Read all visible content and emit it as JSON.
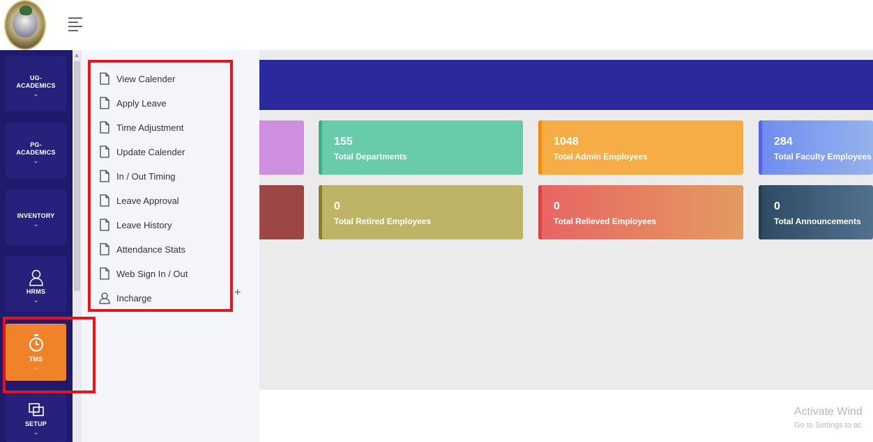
{
  "header": {
    "logo_icon": "college-seal-logo",
    "menu_icon": "hamburger-menu-icon"
  },
  "sidebar": {
    "items": [
      {
        "label": "UG-\nACADEMICS",
        "label_l1": "UG-",
        "label_l2": "ACADEMICS",
        "icon": "chevron-down-icon"
      },
      {
        "label_l1": "PG-",
        "label_l2": "ACADEMICS",
        "icon": "chevron-down-icon"
      },
      {
        "label_l1": "INVENTORY",
        "icon": "chevron-down-icon"
      },
      {
        "label_l1": "HRMS",
        "icon": "user-icon"
      },
      {
        "label_l1": "TMS",
        "icon": "stopwatch-icon",
        "active": true
      },
      {
        "label_l1": "SETUP",
        "icon": "screens-icon"
      }
    ],
    "chevron": "⌄"
  },
  "submenu": {
    "items": [
      {
        "label": "View Calender",
        "icon": "document-icon"
      },
      {
        "label": "Apply Leave",
        "icon": "document-icon"
      },
      {
        "label": "Time Adjustment",
        "icon": "document-icon"
      },
      {
        "label": "Update Calender",
        "icon": "document-icon"
      },
      {
        "label": "In / Out Timing",
        "icon": "document-icon"
      },
      {
        "label": "Leave Approval",
        "icon": "document-icon"
      },
      {
        "label": "Leave History",
        "icon": "document-icon"
      },
      {
        "label": "Attendance Stats",
        "icon": "document-icon"
      },
      {
        "label": "Web Sign In / Out",
        "icon": "document-icon"
      },
      {
        "label": "Incharge",
        "icon": "user-icon"
      }
    ],
    "expand_symbol": "+"
  },
  "cards": [
    {
      "value": "155",
      "label": "Total Departments",
      "color": "#68cba9",
      "edge": "#3fae86"
    },
    {
      "value": "1048",
      "label": "Total Admin Employees",
      "color": "#f6ad45",
      "edge": "#ef8a12"
    },
    {
      "value": "284",
      "label": "Total Faculty Employees",
      "color": "#7c99ef",
      "edge": "#5a62ea"
    },
    {
      "value": "0",
      "label": "Total Retired Employees",
      "color": "#beb466",
      "edge": "#8a7f28"
    },
    {
      "value": "0",
      "label": "Total Relieved Employees",
      "color": "#e56d6d",
      "edge": "#d64444"
    },
    {
      "value": "0",
      "label": "Total Announcements",
      "color": "#3e5b74",
      "edge": "#243e55"
    }
  ],
  "partial_cards": {
    "top_color": "#cf8fe0",
    "bottom_color": "#9c4646"
  },
  "watermark": {
    "line1": "Activate Wind",
    "line2": "Go to Settings to ac"
  }
}
